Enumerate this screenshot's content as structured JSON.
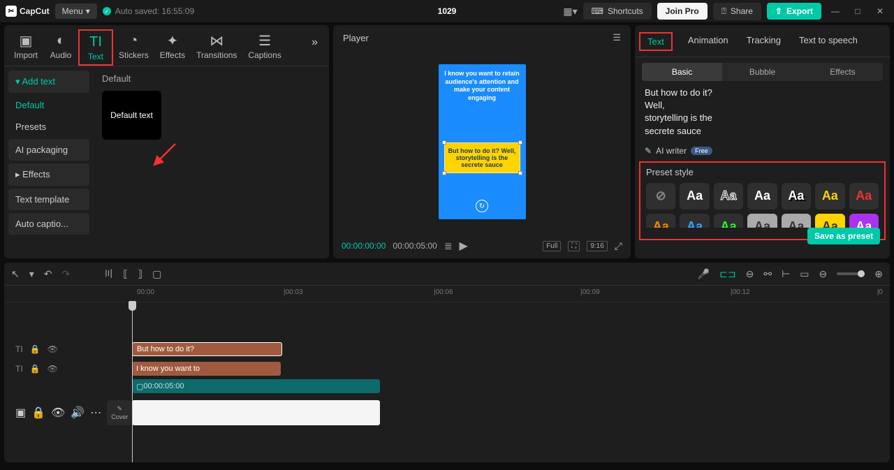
{
  "topbar": {
    "app_name": "CapCut",
    "menu_label": "Menu",
    "autosave_label": "Auto saved: 16:55:09",
    "project_name": "1029",
    "shortcuts": "Shortcuts",
    "join_pro": "Join Pro",
    "share": "Share",
    "export": "Export"
  },
  "tool_tabs": {
    "import": "Import",
    "audio": "Audio",
    "text": "Text",
    "stickers": "Stickers",
    "effects": "Effects",
    "transitions": "Transitions",
    "captions": "Captions"
  },
  "left_sidebar": {
    "add_text": "Add text",
    "default": "Default",
    "presets": "Presets",
    "ai_packaging": "AI packaging",
    "effects": "Effects",
    "text_template": "Text template",
    "auto_captions": "Auto captio..."
  },
  "left_content": {
    "header": "Default",
    "thumb_label": "Default text"
  },
  "player": {
    "title": "Player",
    "white_text": "I know you want to retain audience's attention and make your content engaging",
    "yellow_text": "But how to do it? Well, storytelling is the secrete sauce",
    "time_current": "00:00:00:00",
    "time_total": "00:00:05:00",
    "full": "Full",
    "ratio": "9:16"
  },
  "inspector": {
    "tabs": {
      "text": "Text",
      "animation": "Animation",
      "tracking": "Tracking",
      "tts": "Text to speech"
    },
    "subtabs": {
      "basic": "Basic",
      "bubble": "Bubble",
      "effects": "Effects"
    },
    "text_lines": "But how to do it?\nWell,\nstorytelling is the\nsecrete sauce",
    "ai_writer": "AI writer",
    "free": "Free",
    "preset_style": "Preset style",
    "save_as_preset": "Save as preset"
  },
  "timeline": {
    "ruler": [
      "00:00",
      "|00:03",
      "|00:06",
      "|00:09",
      "|00:12"
    ],
    "clip1": "But how to do it?",
    "clip2": "I know you want to",
    "clip3_time": "00:00:05:00",
    "cover": "Cover"
  }
}
